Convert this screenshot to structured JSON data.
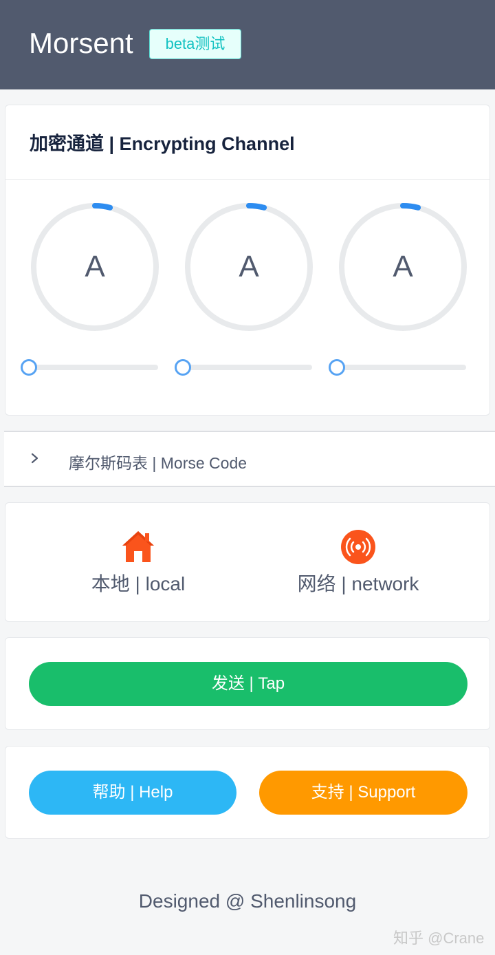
{
  "header": {
    "title": "Morsent",
    "badge": "beta测试"
  },
  "channel": {
    "title": "加密通道 | Encrypting Channel",
    "dials": [
      {
        "letter": "A",
        "progress": 0.04,
        "slider_value": 0
      },
      {
        "letter": "A",
        "progress": 0.04,
        "slider_value": 0
      },
      {
        "letter": "A",
        "progress": 0.04,
        "slider_value": 0
      }
    ]
  },
  "morse_table": {
    "label": "摩尔斯码表 | Morse Code",
    "expanded": false
  },
  "modes": {
    "local": {
      "label": "本地 | local",
      "icon": "home-icon",
      "color": "#fa541c"
    },
    "network": {
      "label": "网络 | network",
      "icon": "broadcast-icon",
      "color": "#fa541c"
    }
  },
  "actions": {
    "send_label": "发送 | Tap",
    "help_label": "帮助 | Help",
    "support_label": "支持 | Support"
  },
  "colors": {
    "header_bg": "#515a6e",
    "badge": "#13c2c2",
    "send": "#19be6b",
    "help": "#2db7f5",
    "support": "#ff9900",
    "accent": "#2d8cf0"
  },
  "footer": {
    "credit": "Designed @ Shenlinsong",
    "watermark": "知乎 @Crane"
  }
}
